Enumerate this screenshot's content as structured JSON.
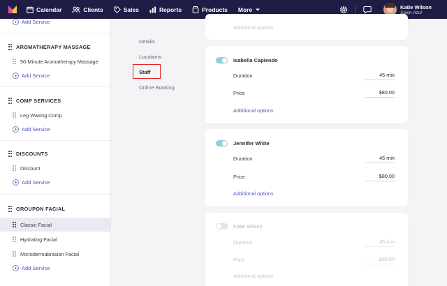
{
  "nav": {
    "items": [
      {
        "label": "Calendar",
        "icon": "calendar-icon"
      },
      {
        "label": "Clients",
        "icon": "clients-icon"
      },
      {
        "label": "Sales",
        "icon": "sales-icon"
      },
      {
        "label": "Reports",
        "icon": "reports-icon"
      },
      {
        "label": "Products",
        "icon": "products-icon"
      }
    ],
    "more_label": "More",
    "user_name": "Katie Wilson",
    "user_subtitle": "Salon Azul"
  },
  "sidebar": {
    "add_service_label": "Add Service",
    "groups": [
      {
        "title": "AROMATHERAPY MASSAGE",
        "services": [
          "50-Minute Aromatherapy Massage"
        ]
      },
      {
        "title": "COMP SERVICES",
        "services": [
          "Leg Waxing Comp"
        ]
      },
      {
        "title": "DISCOUNTS",
        "services": [
          "Discount"
        ]
      },
      {
        "title": "GROUPON FACIAL",
        "services": [
          "Classic Facial",
          "Hydrating Facial",
          "Microdermabrasion Facial"
        ]
      }
    ],
    "active_service": "Classic Facial"
  },
  "subnav": {
    "items": [
      "Details",
      "Locations",
      "Staff",
      "Online Booking"
    ],
    "active": "Staff"
  },
  "staff": {
    "top_additional_options": "Additional options",
    "duration_label": "Duration",
    "price_label": "Price",
    "additional_options": "Additional options",
    "members": [
      {
        "name": "Isabella Capiendo",
        "enabled": true,
        "duration": "45 min",
        "price": "$80.00"
      },
      {
        "name": "Jennifer White",
        "enabled": true,
        "duration": "45 min",
        "price": "$80.00"
      },
      {
        "name": "Katie Wilson",
        "enabled": false,
        "duration": "45 min",
        "price": "$80.00"
      }
    ]
  },
  "colors": {
    "nav_bg": "#1f1d45",
    "accent": "#4b54c8",
    "toggle_on": "#8ad3d8",
    "highlight": "#e02424"
  }
}
